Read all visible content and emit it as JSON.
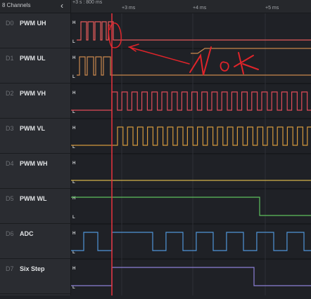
{
  "sidebar": {
    "title": "8 Channels",
    "collapse_icon": "chevron-left-icon",
    "channels": [
      {
        "num": "D0",
        "name": "PWM UH",
        "color": "#e35a5a"
      },
      {
        "num": "D1",
        "name": "PWM UL",
        "color": "#c9884e"
      },
      {
        "num": "D2",
        "name": "PWM VH",
        "color": "#e04b58"
      },
      {
        "num": "D3",
        "name": "PWM VL",
        "color": "#d4993e"
      },
      {
        "num": "D4",
        "name": "PWM WH",
        "color": "#d4b34a"
      },
      {
        "num": "D5",
        "name": "PWM WL",
        "color": "#5ec15e"
      },
      {
        "num": "D6",
        "name": "ADC",
        "color": "#4f95d8"
      },
      {
        "num": "D7",
        "name": "Six Step",
        "color": "#8c7fd6"
      }
    ]
  },
  "timeline": {
    "origin": "+3 s : 800 ms",
    "ticks": [
      "+3 ms",
      "+4 ms",
      "+5 ms"
    ]
  },
  "levels": {
    "high": "H",
    "low": "L"
  },
  "annotation": {
    "text": "NOK",
    "color": "#e0242a"
  },
  "cursor_color": "#e8333d"
}
